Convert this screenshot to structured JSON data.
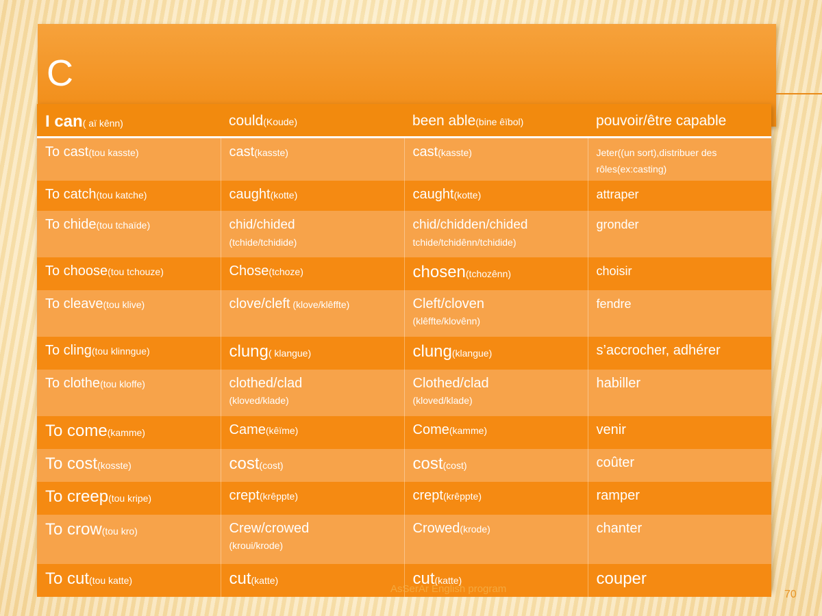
{
  "slide": {
    "title": "C",
    "footer": "AsSerAr English program",
    "page_number": "70"
  },
  "table": {
    "header": {
      "c1_main": "I can",
      "c1_pron": "( aï kênn)",
      "c2_main": "could",
      "c2_pron": "(Koude)",
      "c3_main": "been able",
      "c3_pron": "(bine êïbol)",
      "c4": "pouvoir/être capable"
    },
    "rows": [
      {
        "c1": "To cast",
        "c1p": "(tou kasste)",
        "c2": "cast",
        "c2p": "(kasste)",
        "c3": "cast",
        "c3p": "(kasste)",
        "c4": "Jeter((un sort),distribuer des rôles(ex:casting)"
      },
      {
        "c1": "To catch",
        "c1p": "(tou katche)",
        "c2": "caught",
        "c2p": "(kotte)",
        "c3": "caught",
        "c3p": "(kotte)",
        "c4": "attraper"
      },
      {
        "c1": "To chide",
        "c1p": "(tou tchaïde)",
        "c2": "chid/chided",
        "c2p": "(tchide/tchidide)",
        "c3": "chid/chidden/chided",
        "c3p": "tchide/tchidênn/tchidide)",
        "c4": "gronder"
      },
      {
        "c1": "To choose",
        "c1p": "(tou tchouze)",
        "c2": "Chose",
        "c2p": "(tchoze)",
        "c3": "chosen",
        "c3p": "(tchozênn)",
        "c4": "choisir"
      },
      {
        "c1": "To cleave",
        "c1p": "(tou klive)",
        "c2": "clove/cleft",
        "c2p": " (klove/klêffte)",
        "c3": "Cleft/cloven",
        "c3p": "(klêffte/klovênn)",
        "c4": "fendre"
      },
      {
        "c1": "To  cling",
        "c1p": "(tou klinngue)",
        "c2": "clung",
        "c2p": "( klangue)",
        "c3": "clung",
        "c3p": "(klangue)",
        "c4": "s’accrocher, adhérer"
      },
      {
        "c1": "To clothe",
        "c1p": "(tou kloffe)",
        "c2": "clothed/clad",
        "c2p": "(kloved/klade)",
        "c3": "Clothed/clad",
        "c3p": "(kloved/klade)",
        "c4": "habiller"
      },
      {
        "c1": "To  come",
        "c1p": "(kamme)",
        "c2": "Came",
        "c2p": "(kêïme)",
        "c3": "Come",
        "c3p": "(kamme)",
        "c4": "venir"
      },
      {
        "c1": "To  cost",
        "c1p": "(kosste)",
        "c2": "cost",
        "c2p": "(cost)",
        "c3": "cost",
        "c3p": "(cost)",
        "c4": "coûter"
      },
      {
        "c1": "To creep",
        "c1p": "(tou kripe)",
        "c2": "crept",
        "c2p": "(krêppte)",
        "c3": "crept",
        "c3p": "(krêppte)",
        "c4": "ramper"
      },
      {
        "c1": "To  crow",
        "c1p": "(tou kro)",
        "c2": "Crew/crowed",
        "c2p": "(kroui/krode)",
        "c3": "Crowed",
        "c3p": "(krode)",
        "c4": "chanter"
      },
      {
        "c1": "To  cut",
        "c1p": "(tou katte)",
        "c2": "cut",
        "c2p": "(katte)",
        "c3": "cut",
        "c3p": "(katte)",
        "c4": "couper"
      }
    ]
  }
}
